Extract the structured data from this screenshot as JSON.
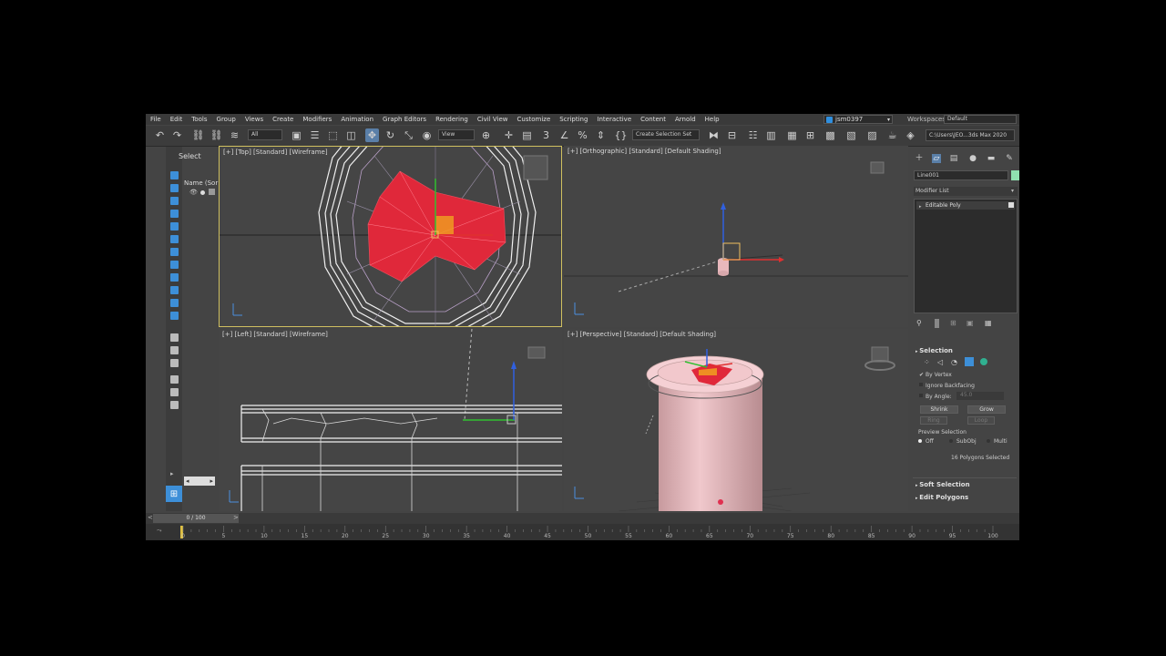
{
  "menu": [
    "File",
    "Edit",
    "Tools",
    "Group",
    "Views",
    "Create",
    "Modifiers",
    "Animation",
    "Graph Editors",
    "Rendering",
    "Civil View",
    "Customize",
    "Scripting",
    "Interactive",
    "Content",
    "Arnold",
    "Help"
  ],
  "user": "jsm0397",
  "workspaces_label": "Workspaces:",
  "workspace": "Default",
  "toolbar": {
    "filter": "All",
    "view": "View",
    "selection_set": "Create Selection Set",
    "project_path": "C:\\Users\\JEO...3ds Max 2020"
  },
  "scene_explorer": {
    "select_label": "Select",
    "name_column": "Name (Sor"
  },
  "viewports": {
    "top": "[+] [Top] [Standard] [Wireframe]",
    "ortho": "[+] [Orthographic] [Standard] [Default Shading]",
    "left": "[+] [Left] [Standard] [Wireframe]",
    "persp": "[+] [Perspective] [Standard] [Default Shading]"
  },
  "command_panel": {
    "object_name": "Line001",
    "object_color": "#8fe0b0",
    "modifier_list": "Modifier List",
    "modifier": "Editable Poly",
    "selection": {
      "title": "Selection",
      "by_vertex": "By Vertex",
      "ignore_backfacing": "Ignore Backfacing",
      "by_angle": "By Angle:",
      "angle_value": "45.0",
      "shrink": "Shrink",
      "grow": "Grow",
      "ring": "Ring",
      "loop": "Loop",
      "preview_selection": "Preview Selection",
      "off": "Off",
      "subobj": "SubObj",
      "multi": "Multi",
      "status": "16 Polygons Selected"
    },
    "soft_selection": "Soft Selection",
    "edit_polygons": "Edit Polygons"
  },
  "timeline": {
    "slider": "0 / 100",
    "ticks": [
      "0",
      "5",
      "10",
      "15",
      "20",
      "25",
      "30",
      "35",
      "40",
      "45",
      "50",
      "55",
      "60",
      "65",
      "70",
      "75",
      "80",
      "85",
      "90",
      "95",
      "100"
    ]
  },
  "colors": {
    "selection_red": "#e0283a",
    "object_pink": "#e8b8bc",
    "viewport_bg": "#454545",
    "accent_blue": "#3d8fd8",
    "active_frame": "#d0c060"
  }
}
